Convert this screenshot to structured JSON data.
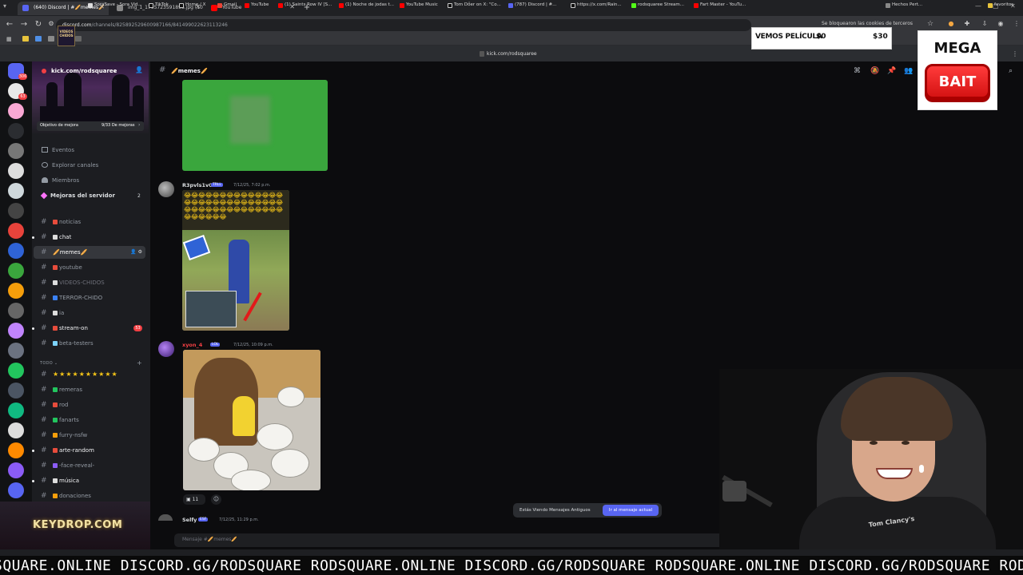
{
  "browser": {
    "tabs": [
      {
        "title": "(640) Discord | #🥖memes🥖",
        "active": true,
        "color": "#5865f2"
      },
      {
        "title": "img_1_1765723591895.jpg (10",
        "active": false,
        "color": "#888888"
      },
      {
        "title": "YouTube",
        "active": false,
        "color": "#ff0000"
      }
    ],
    "url_host": "discord.com",
    "url_path": "/channels/825892529600987166/841499022623113246",
    "third_party_notice": "Se bloquearon las cookies de terceros",
    "bookmarks": [
      "SoraSave - Sora Vid...",
      "TikTok",
      "Home / X",
      "Gmail",
      "YouTube",
      "(1) Saints Row IV [S...",
      "(1) Noche de jodas t...",
      "YouTube Music",
      "Tom Dőer on X: \"Co...",
      "(787) Discord | #...",
      "https://x.com/Rain...",
      "rodsquaree Stream...",
      "Fart Master - YouTu...",
      "Hechos Pert...",
      "favoritos"
    ],
    "kick_url": "kick.com/rodsquaree"
  },
  "server": {
    "name": "kick.com/rodsquaree",
    "banner_sign": "VIDEOS CHIDOS",
    "boost_goal_label": "Objetivo de mejora",
    "boost_goal_count": "9/33 De mejoras"
  },
  "rail_badges": [
    "306",
    "63",
    "",
    "",
    "",
    "",
    "",
    "",
    "",
    "",
    "",
    "",
    "",
    "",
    "",
    "",
    "",
    "",
    "",
    "",
    "",
    "",
    "",
    "98",
    ""
  ],
  "nav": [
    {
      "label": "Eventos",
      "icon": "calendar-icon"
    },
    {
      "label": "Explorar canales",
      "icon": "compass-icon"
    },
    {
      "label": "Miembros",
      "icon": "members-icon"
    },
    {
      "label": "Mejoras del servidor",
      "icon": "boost-icon",
      "count": "2"
    }
  ],
  "channels": [
    {
      "name": "noticias",
      "emoji_color": "#e74c3c",
      "style": "normal"
    },
    {
      "name": "chat",
      "emoji_color": "#dddddd",
      "style": "bold"
    },
    {
      "name": "🥖memes🥖",
      "emoji_color": "",
      "style": "selected"
    },
    {
      "name": "youtube",
      "emoji_color": "#e74c3c",
      "style": "normal"
    },
    {
      "name": "VIDEOS-CHIDOS",
      "emoji_color": "#dddddd",
      "style": "dim"
    },
    {
      "name": "TERROR-CHIDO",
      "emoji_color": "#3b82f6",
      "style": "normal"
    },
    {
      "name": "ia",
      "emoji_color": "#dddddd",
      "style": "normal"
    },
    {
      "name": "stream-on",
      "emoji_color": "#e74c3c",
      "style": "bold",
      "badge": "53"
    },
    {
      "name": "beta-testers",
      "emoji_color": "#7dd3fc",
      "style": "normal"
    }
  ],
  "category_label": "TODO",
  "channels2": [
    {
      "name": "★★★★★★★★★★",
      "style": "stars"
    },
    {
      "name": "remeras",
      "emoji_color": "#22c55e",
      "style": "normal"
    },
    {
      "name": "rod",
      "emoji_color": "#e74c3c",
      "style": "normal"
    },
    {
      "name": "fanarts",
      "emoji_color": "#22c55e",
      "style": "normal"
    },
    {
      "name": "furry-nsfw",
      "emoji_color": "#f59e0b",
      "style": "normal"
    },
    {
      "name": "arte-random",
      "emoji_color": "#e74c3c",
      "style": "bold"
    },
    {
      "name": "-face-reveal-",
      "emoji_color": "#8b5cf6",
      "style": "normal"
    },
    {
      "name": "música",
      "emoji_color": "#dddddd",
      "style": "bold"
    },
    {
      "name": "donaciones",
      "emoji_color": "#f59e0b",
      "style": "normal"
    }
  ],
  "keydrop": "KEYDROP.COM",
  "channel_header": {
    "name": "🥖memes🥖"
  },
  "messages": [
    {
      "author": "R3pvls1v0",
      "tag": "TRLL",
      "time": "7/12/25, 7:02 p.m.",
      "author_color": "#f2f3f5"
    },
    {
      "author": "xyon_4",
      "tag": "LOL",
      "time": "7/12/25, 10:09 p.m.",
      "author_color": "#f23f43"
    },
    {
      "author": "Selfy",
      "tag": "ESF",
      "time": "7/12/25, 11:29 p.m.",
      "author_color": "#f2f3f5"
    }
  ],
  "reaction_count": "11",
  "old_messages": {
    "text": "Estás Viendo Mensajes Antiguos",
    "button": "Ir al mensaje actual"
  },
  "composer_placeholder": "Mensaje #🥖memes🥖",
  "overlay_movie": {
    "label": "VEMOS PELÍCULA",
    "v1": "$0",
    "v2": "$30"
  },
  "overlay_bait": {
    "top": "MEGA",
    "button": "BAIT"
  },
  "shirt_print": "Tom Clancy's",
  "ticker": "SQUARE.ONLINE DISCORD.GG/RODSQUARE RODSQUARE.ONLINE DISCORD.GG/RODSQUARE RODSQUARE.ONLINE DISCORD.GG/RODSQUARE RODS"
}
